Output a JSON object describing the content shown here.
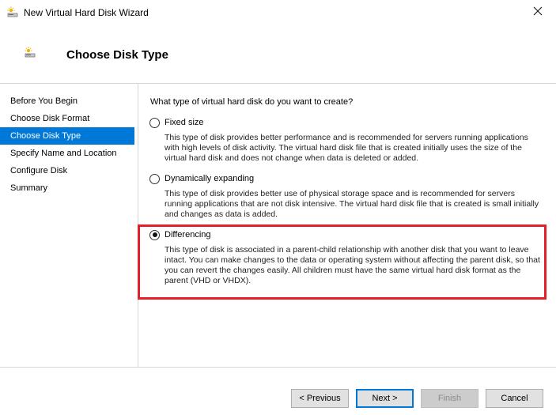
{
  "window": {
    "title": "New Virtual Hard Disk Wizard"
  },
  "header": {
    "title": "Choose Disk Type"
  },
  "sidebar": {
    "items": [
      {
        "label": "Before You Begin"
      },
      {
        "label": "Choose Disk Format"
      },
      {
        "label": "Choose Disk Type"
      },
      {
        "label": "Specify Name and Location"
      },
      {
        "label": "Configure Disk"
      },
      {
        "label": "Summary"
      }
    ],
    "active_index": 2
  },
  "main": {
    "question": "What type of virtual hard disk do you want to create?",
    "options": [
      {
        "label": "Fixed size",
        "description": "This type of disk provides better performance and is recommended for servers running applications with high levels of disk activity. The virtual hard disk file that is created initially uses the size of the virtual hard disk and does not change when data is deleted or added.",
        "selected": false
      },
      {
        "label": "Dynamically expanding",
        "description": "This type of disk provides better use of physical storage space and is recommended for servers running applications that are not disk intensive. The virtual hard disk file that is created is small initially and changes as data is added.",
        "selected": false
      },
      {
        "label": "Differencing",
        "description": "This type of disk is associated in a parent-child relationship with another disk that you want to leave intact. You can make changes to the data or operating system without affecting the parent disk, so that you can revert the changes easily. All children must have the same virtual hard disk format as the parent (VHD or VHDX).",
        "selected": true
      }
    ]
  },
  "buttons": {
    "previous": "< Previous",
    "next": "Next >",
    "finish": "Finish",
    "cancel": "Cancel"
  },
  "colors": {
    "accent": "#0078d7",
    "highlight": "#e3202a"
  },
  "icons": {
    "app": "disk-wizard-icon",
    "close": "close-icon"
  }
}
